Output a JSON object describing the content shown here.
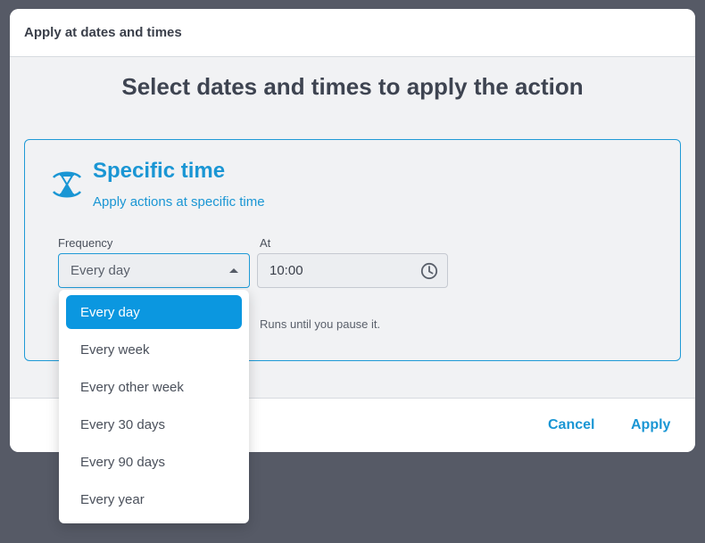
{
  "dialog": {
    "title": "Apply at dates and times",
    "heading": "Select dates and times to apply the action"
  },
  "card": {
    "icon": "hourglass-icon",
    "title": "Specific time",
    "subtitle": "Apply actions at specific time",
    "frequency_label": "Frequency",
    "frequency_value": "Every day",
    "at_label": "At",
    "at_value": "10:00",
    "note": "Runs until you pause it."
  },
  "footer": {
    "cancel_label": "Cancel",
    "apply_label": "Apply"
  },
  "dropdown": {
    "options": [
      "Every day",
      "Every week",
      "Every other week",
      "Every 30 days",
      "Every 90 days",
      "Every year"
    ],
    "selected_index": 0
  },
  "colors": {
    "accent": "#1a96d4",
    "selected_option_bg": "#0b97e0",
    "backdrop": "#565a66"
  }
}
